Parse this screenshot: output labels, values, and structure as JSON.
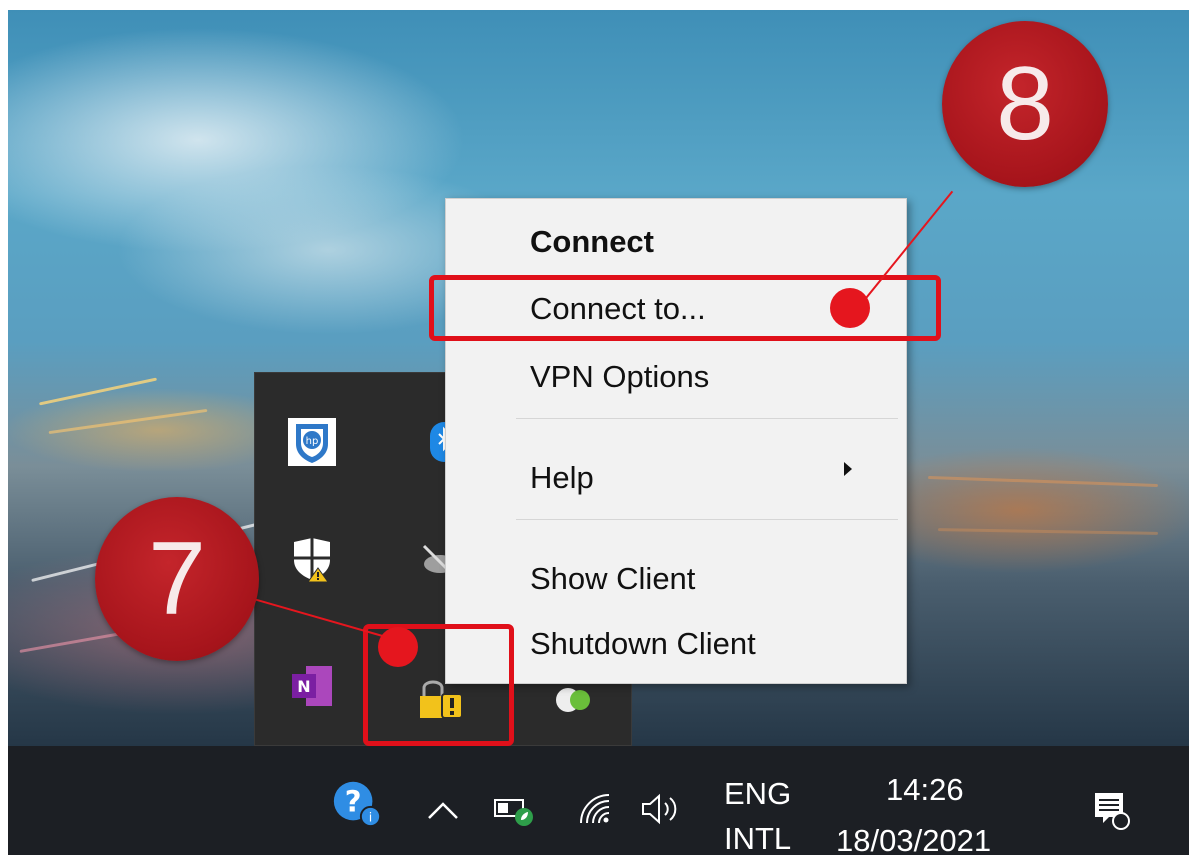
{
  "context_menu": {
    "items": [
      {
        "label": "Connect"
      },
      {
        "label": "Connect to..."
      },
      {
        "label": "VPN Options"
      },
      {
        "label": "Help"
      },
      {
        "label": "Show Client"
      },
      {
        "label": "Shutdown Client"
      }
    ]
  },
  "annotations": {
    "step_connect_to": "8",
    "step_vpn_tray_icon": "7",
    "highlight_color": "#e0101a"
  },
  "taskbar": {
    "language": "ENG",
    "keyboard": "INTL",
    "time": "14:26",
    "date": "18/03/2021"
  },
  "tray_icons": [
    "hp-shield-icon",
    "bluetooth-icon",
    "windows-security-warning-icon",
    "onedrive-icon",
    "onenote-icon",
    "vpn-client-warning-icon",
    "green-status-icon"
  ],
  "taskbar_icons": [
    "help-icon",
    "chevron-up-icon",
    "battery-icon",
    "wifi-icon",
    "volume-icon",
    "notifications-icon"
  ]
}
